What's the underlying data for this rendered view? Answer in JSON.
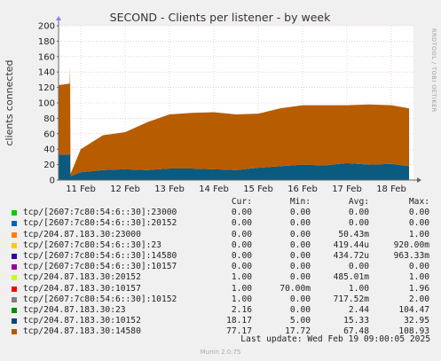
{
  "chart_data": {
    "type": "area",
    "title": "SECOND - Clients per listener - by week",
    "ylabel": "clients connected",
    "ylim": [
      0,
      200
    ],
    "yticks": [
      0,
      20,
      40,
      60,
      80,
      100,
      120,
      140,
      160,
      180,
      200
    ],
    "ytick_labels": [
      "0",
      "20",
      "40",
      "60",
      "80",
      "100",
      "120",
      "140",
      "160",
      "180",
      "200"
    ],
    "xticks": [
      "11 Feb",
      "12 Feb",
      "13 Feb",
      "14 Feb",
      "15 Feb",
      "16 Feb",
      "17 Feb",
      "18 Feb"
    ],
    "grid": true,
    "x": [
      0,
      0.25,
      0.26,
      0.27,
      0.5,
      1,
      1.5,
      2,
      2.5,
      3,
      3.5,
      4,
      4.5,
      5,
      5.5,
      6,
      6.5,
      7,
      7.5,
      7.9
    ],
    "series": [
      {
        "name": "tcp/204.87.183.30:10152",
        "color": "#0b5a80",
        "values": [
          33,
          33,
          35,
          5,
          10,
          13,
          14,
          13,
          15,
          15,
          14,
          13,
          16,
          18,
          20,
          19,
          22,
          20,
          21,
          18
        ]
      },
      {
        "name": "tcp/204.87.183.30:14580",
        "color": "#b85c00",
        "values": [
          90,
          92,
          112,
          3,
          30,
          45,
          48,
          62,
          70,
          72,
          74,
          72,
          70,
          75,
          77,
          78,
          75,
          78,
          76,
          75
        ]
      }
    ]
  },
  "legend": {
    "header": {
      "cur": "Cur:",
      "min": "Min:",
      "avg": "Avg:",
      "max": "Max:"
    },
    "rows": [
      {
        "name": "tcp/[2607:7c80:54:6::30]:23000",
        "color": "#00cc00",
        "cur": "0.00",
        "min": "0.00",
        "avg": "0.00",
        "max": "0.00"
      },
      {
        "name": "tcp/[2607:7c80:54:6::30]:20152",
        "color": "#0066b3",
        "cur": "0.00",
        "min": "0.00",
        "avg": "0.00",
        "max": "0.00"
      },
      {
        "name": "tcp/204.87.183.30:23000",
        "color": "#ff8000",
        "cur": "0.00",
        "min": "0.00",
        "avg": "50.43m",
        "max": "1.00"
      },
      {
        "name": "tcp/[2607:7c80:54:6::30]:23",
        "color": "#ffcc00",
        "cur": "0.00",
        "min": "0.00",
        "avg": "419.44u",
        "max": "920.00m"
      },
      {
        "name": "tcp/[2607:7c80:54:6::30]:14580",
        "color": "#330099",
        "cur": "0.00",
        "min": "0.00",
        "avg": "434.72u",
        "max": "963.33m"
      },
      {
        "name": "tcp/[2607:7c80:54:6::30]:10157",
        "color": "#990099",
        "cur": "0.00",
        "min": "0.00",
        "avg": "0.00",
        "max": "0.00"
      },
      {
        "name": "tcp/204.87.183.30:20152",
        "color": "#ccff00",
        "cur": "1.00",
        "min": "0.00",
        "avg": "485.01m",
        "max": "1.00"
      },
      {
        "name": "tcp/204.87.183.30:10157",
        "color": "#ff0000",
        "cur": "1.00",
        "min": "70.00m",
        "avg": "1.00",
        "max": "1.96"
      },
      {
        "name": "tcp/[2607:7c80:54:6::30]:10152",
        "color": "#808080",
        "cur": "1.00",
        "min": "0.00",
        "avg": "717.52m",
        "max": "2.00"
      },
      {
        "name": "tcp/204.87.183.30:23",
        "color": "#008f00",
        "cur": "2.16",
        "min": "0.00",
        "avg": "2.44",
        "max": "104.47"
      },
      {
        "name": "tcp/204.87.183.30:10152",
        "color": "#00487d",
        "cur": "18.17",
        "min": "5.00",
        "avg": "15.33",
        "max": "32.95"
      },
      {
        "name": "tcp/204.87.183.30:14580",
        "color": "#b35a00",
        "cur": "77.17",
        "min": "17.72",
        "avg": "67.48",
        "max": "108.93"
      }
    ]
  },
  "last_update": "Last update: Wed Feb 19 09:00:05 2025",
  "watermark": "RRDTOOL / TOBI OETIKER",
  "footer": "Munin 2.0.75"
}
